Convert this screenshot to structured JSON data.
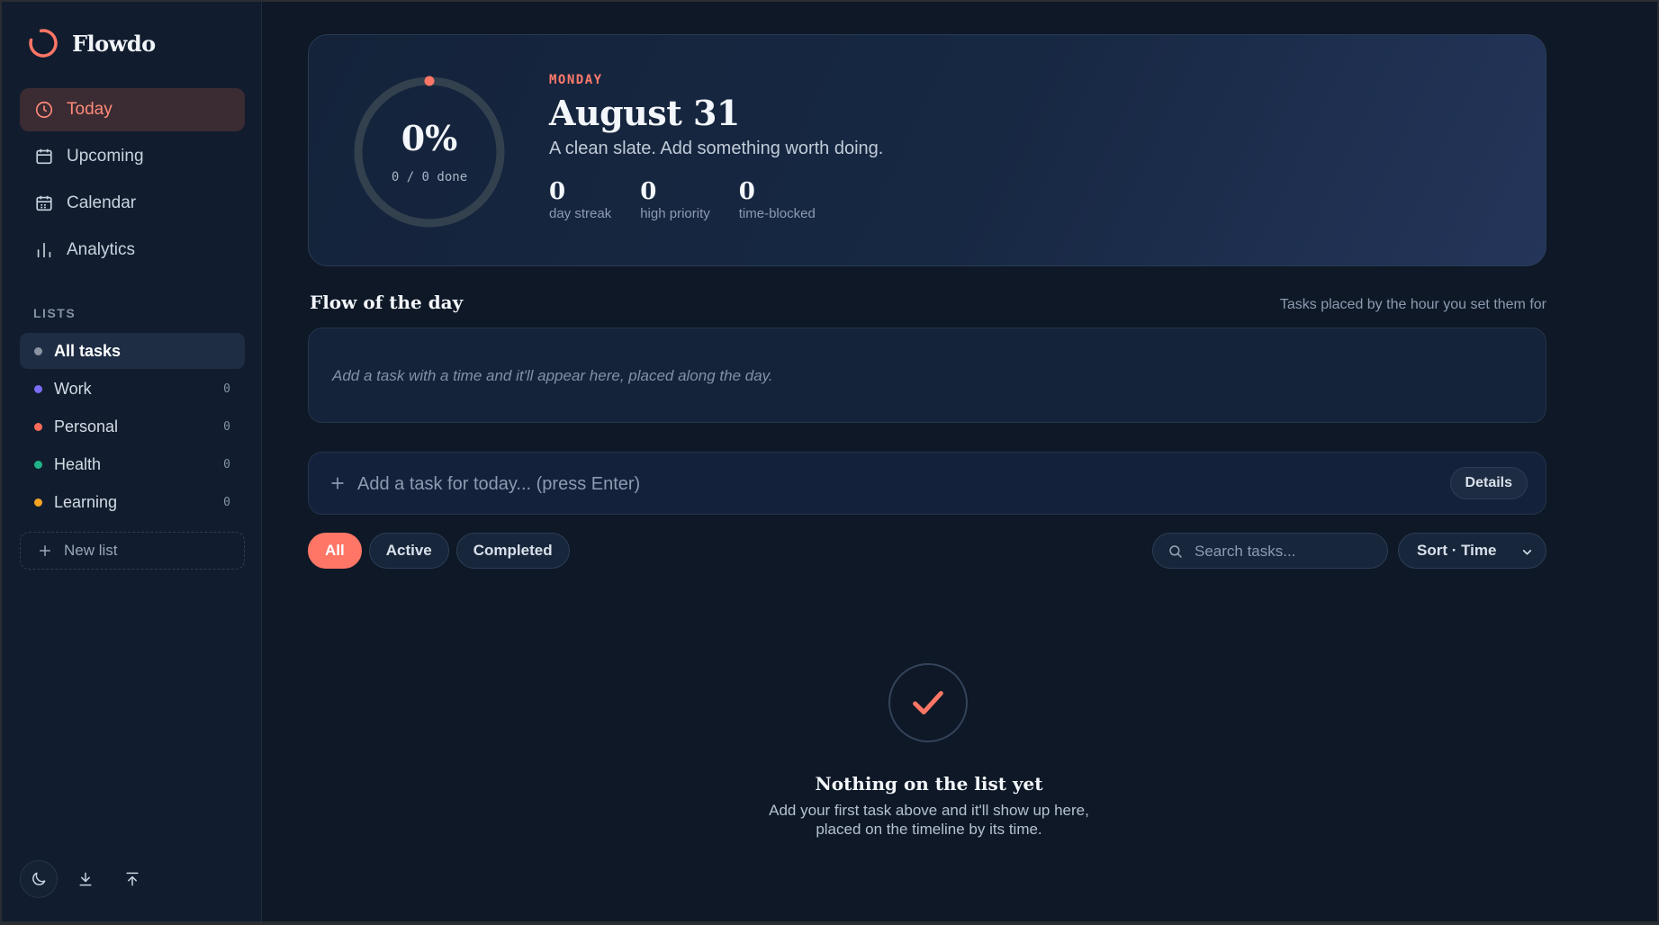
{
  "app": {
    "name": "Flowdo"
  },
  "nav": {
    "items": [
      {
        "label": "Today",
        "icon": "clock-icon",
        "active": true
      },
      {
        "label": "Upcoming",
        "icon": "calendar-icon"
      },
      {
        "label": "Calendar",
        "icon": "calendar-grid-icon"
      },
      {
        "label": "Analytics",
        "icon": "bar-chart-icon"
      }
    ]
  },
  "lists": {
    "section_label": "LISTS",
    "items": [
      {
        "label": "All tasks",
        "color": "#8b93a3",
        "count": ""
      },
      {
        "label": "Work",
        "color": "#7b6cf6",
        "count": "0"
      },
      {
        "label": "Personal",
        "color": "#ff6b5b",
        "count": "0"
      },
      {
        "label": "Health",
        "color": "#22b38a",
        "count": "0"
      },
      {
        "label": "Learning",
        "color": "#f5a524",
        "count": "0"
      }
    ],
    "new_list_label": "New list"
  },
  "hero": {
    "progress_percent": "0%",
    "progress_value": 0,
    "done_text": "0 / 0 done",
    "weekday": "MONDAY",
    "date": "August 31",
    "subtitle": "A clean slate. Add something worth doing.",
    "stats": [
      {
        "value": "0",
        "label": "day streak"
      },
      {
        "value": "0",
        "label": "high priority"
      },
      {
        "value": "0",
        "label": "time-blocked"
      }
    ]
  },
  "flow": {
    "title": "Flow of the day",
    "hint": "Tasks placed by the hour you set them for",
    "empty_text": "Add a task with a time and it'll appear here, placed along the day."
  },
  "add_task": {
    "placeholder": "Add a task for today... (press Enter)",
    "details_label": "Details"
  },
  "filters": {
    "chips": [
      {
        "label": "All",
        "active": true
      },
      {
        "label": "Active"
      },
      {
        "label": "Completed"
      }
    ],
    "search_placeholder": "Search tasks...",
    "sort_label": "Sort · Time"
  },
  "empty_state": {
    "title": "Nothing on the list yet",
    "line1": "Add your first task above and it'll show up here,",
    "line2": "placed on the timeline by its time."
  },
  "colors": {
    "accent": "#ff7666",
    "background": "#0e1826",
    "sidebar": "#111d2e"
  }
}
